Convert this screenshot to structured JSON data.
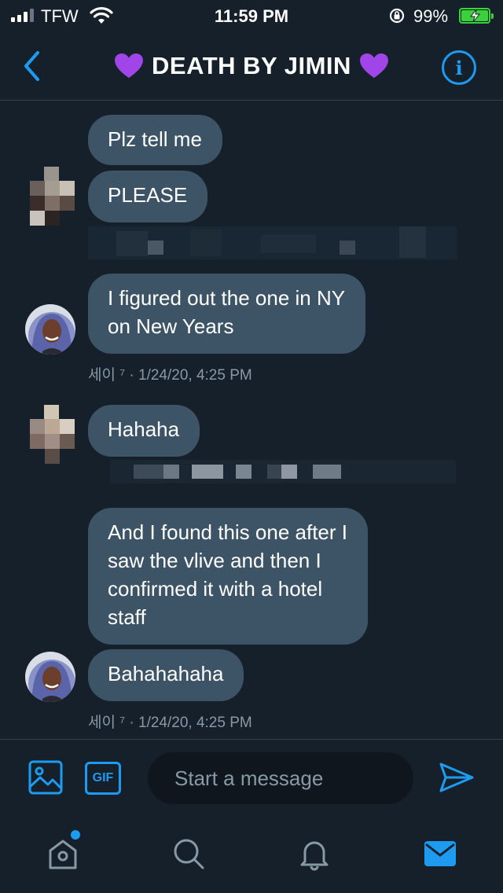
{
  "status_bar": {
    "carrier": "TFW",
    "time": "11:59 PM",
    "battery_percent": "99%",
    "battery_level": 0.99,
    "signal_bars": 3
  },
  "header": {
    "title": "DEATH BY JIMIN",
    "left_icon": "back-chevron-icon",
    "right_icon": "info-icon",
    "title_emoji": "purple-heart",
    "accent_color": "#1d9bf0"
  },
  "messages": [
    {
      "text": "Plz tell me"
    },
    {
      "text": "PLEASE"
    },
    {
      "text": "I figured out the one in NY\non New Years"
    },
    {
      "text": "Hahaha"
    },
    {
      "text": "And I found this one after I\nsaw the vlive and then I\nconfirmed it with a hotel\nstaff"
    },
    {
      "text": "Bahahahaha"
    }
  ],
  "meta_lines": [
    {
      "sender": "세이 ⁷",
      "timestamp": "1/24/20, 4:25 PM"
    },
    {
      "sender": "세이 ⁷",
      "timestamp": "1/24/20, 4:25 PM"
    }
  ],
  "composer": {
    "placeholder": "Start a message",
    "gif_label": "GIF",
    "value": ""
  },
  "tab_bar": {
    "items": [
      "home-icon",
      "search-icon",
      "notifications-icon",
      "messages-icon"
    ],
    "active": "messages-icon",
    "home_has_new": true
  },
  "colors": {
    "background": "#15202b",
    "bubble": "#3d5466",
    "accent": "#1d9bf0",
    "muted_text": "#8899a6"
  }
}
